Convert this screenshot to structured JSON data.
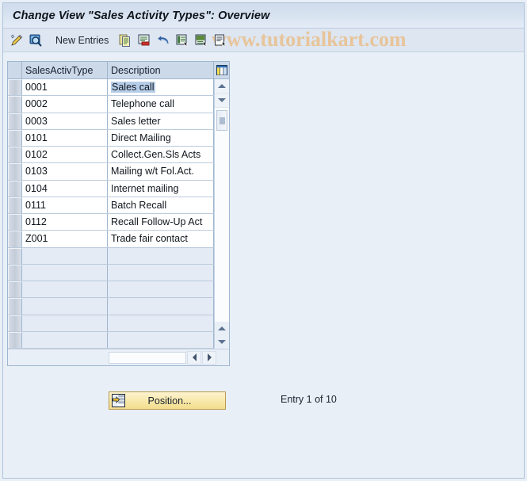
{
  "window": {
    "title": "Change View \"Sales Activity Types\": Overview"
  },
  "toolbar": {
    "new_entries_label": "New Entries",
    "buttons": [
      {
        "name": "display-change-icon",
        "icon": "pencil-icon"
      },
      {
        "name": "find-icon",
        "icon": "magnifier-icon"
      },
      {
        "name": "copy-as-icon",
        "icon": "copy-icon"
      },
      {
        "name": "delete-icon",
        "icon": "delete-icon"
      },
      {
        "name": "undo-icon",
        "icon": "undo-icon"
      },
      {
        "name": "select-all-icon",
        "icon": "select-all-icon"
      },
      {
        "name": "deselect-all-icon",
        "icon": "deselect-all-icon"
      },
      {
        "name": "details-icon",
        "icon": "details-icon"
      }
    ],
    "watermark": "www.tutorialkart.com",
    "watermark_color": "#e8c49a"
  },
  "table": {
    "columns": [
      "SalesActivType",
      "Description"
    ],
    "selected_row_index": 0,
    "selected_cell_text": "Sales call",
    "rows": [
      {
        "key": "0001",
        "description": "Sales call"
      },
      {
        "key": "0002",
        "description": "Telephone call"
      },
      {
        "key": "0003",
        "description": "Sales letter"
      },
      {
        "key": "0101",
        "description": "Direct Mailing"
      },
      {
        "key": "0102",
        "description": "Collect.Gen.Sls Acts"
      },
      {
        "key": "0103",
        "description": "Mailing w/t Fol.Act."
      },
      {
        "key": "0104",
        "description": "Internet mailing"
      },
      {
        "key": "0111",
        "description": "Batch Recall"
      },
      {
        "key": "0112",
        "description": "Recall Follow-Up Act"
      },
      {
        "key": "Z001",
        "description": "Trade fair contact"
      }
    ],
    "empty_row_count": 6,
    "config_icon": "table-settings-icon"
  },
  "footer": {
    "position_button_label": "Position...",
    "position_button_icon": "position-icon",
    "entry_status": "Entry 1 of 10"
  },
  "colors": {
    "page_background": "#e9eff7",
    "title_bar": "#d7e2f0",
    "header_row": "#ccd9e8",
    "row_background": "#ffffff",
    "empty_row_background": "#e4ebf5",
    "selection_highlight": "#b6cde8",
    "button_yellow": "#f8e8a8",
    "border": "#9fb6cf"
  }
}
